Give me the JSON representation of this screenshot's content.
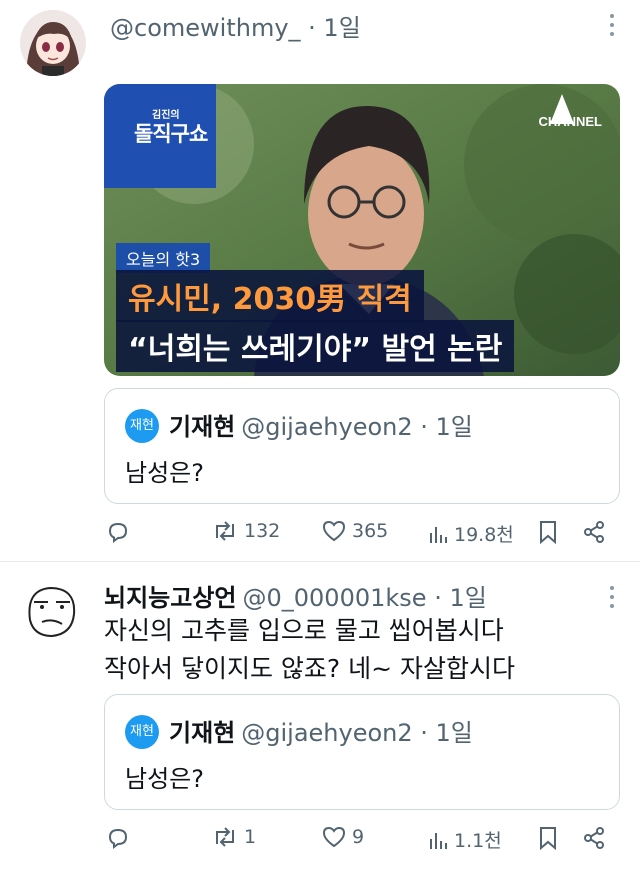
{
  "tweet1": {
    "handle": "@comewithmy_",
    "time": "· 1일",
    "media": {
      "logo_small": "김진의",
      "logo_big": "돌직구쇼",
      "channel": "CHANNEL",
      "tag": "오늘의 핫3",
      "headline_1": "유시민, 2030男 직격",
      "headline_2": "“너희는 쓰레기야” 발언 논란"
    },
    "quote": {
      "avatar_text": "재현",
      "name": "기재현",
      "handle": "@gijaehyeon2",
      "time": "· 1일",
      "text": "남성은?"
    },
    "actions": {
      "reply_icon": "reply-icon",
      "retweets": "132",
      "likes": "365",
      "views": "19.8천",
      "bookmark_icon": "bookmark-icon",
      "share_icon": "share-icon"
    }
  },
  "tweet2": {
    "name": "뇌지능고상언",
    "handle": "@0_000001kse",
    "time": "· 1일",
    "line1": "자신의 고추를 입으로 물고 씹어봅시다",
    "line2": "작아서 닿이지도 않죠? 네~ 자살합시다",
    "quote": {
      "avatar_text": "재현",
      "name": "기재현",
      "handle": "@gijaehyeon2",
      "time": "· 1일",
      "text": "남성은?"
    },
    "actions": {
      "reply_icon": "reply-icon",
      "retweets": "1",
      "likes": "9",
      "views": "1.1천",
      "bookmark_icon": "bookmark-icon",
      "share_icon": "share-icon"
    }
  },
  "colors": {
    "text": "#0f1419",
    "secondary": "#536471",
    "accent": "#1d9bf0",
    "headline_orange": "#ff9a3c"
  }
}
